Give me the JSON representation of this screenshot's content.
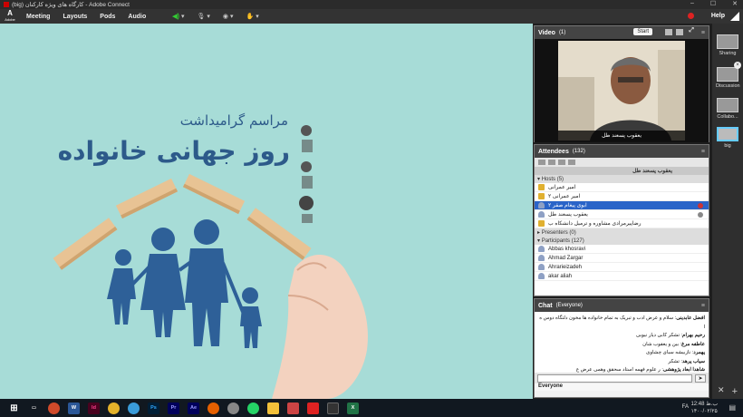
{
  "window": {
    "title": "(big) کارگاه های ویژه کارکنان - Adobe Connect"
  },
  "menubar": {
    "logo_letter": "A",
    "logo_sub": "Adobe",
    "items": [
      "Meeting",
      "Layouts",
      "Pods",
      "Audio"
    ],
    "help": "Help"
  },
  "stage": {
    "title_small": "مراسم گرامیداشت",
    "title_big": "روز جهانی خانواده"
  },
  "video_pod": {
    "title": "Video",
    "count": "(1)",
    "start_label": "Start",
    "person_name": "یعقوب پسعند طل"
  },
  "attendees_pod": {
    "title": "Attendees",
    "count": "(132)",
    "current_user": "یعقوب پسعند طل",
    "hosts_label": "Hosts (5)",
    "hosts": [
      {
        "name": "امیر عمرانی",
        "selected": false,
        "badge": ""
      },
      {
        "name": "امیر عمرانی ۲",
        "selected": false,
        "badge": ""
      },
      {
        "name": "۲ ابوی پیغام صقر",
        "selected": true,
        "badge": "red"
      },
      {
        "name": "یعقوب پسعند طل",
        "selected": false,
        "badge": "gray"
      },
      {
        "name": "رضاپیرمرادی مشاوره و ترمیل دانشکاه ب",
        "selected": false,
        "badge": ""
      }
    ],
    "presenters_label": "Presenters (0)",
    "participants_label": "Participants (127)",
    "participants": [
      "Abbas khosravi",
      "Ahmad Zargar",
      "Ahrarieizadeh",
      "akar aliah"
    ]
  },
  "chat_pod": {
    "title": "Chat",
    "scope": "(Everyone)",
    "messages": [
      {
        "user": "افضل عابدینی",
        "text": "سلام و عرض ادب و تبریک به تمام خانواده  ها مخون دلتگاه دوس ه ا"
      },
      {
        "user": "رحیم بهرام",
        "text": "تشکر کابی دیار نیوبی"
      },
      {
        "user": "عاطفه مرغ",
        "text": "بین و یعقوب شان"
      },
      {
        "user": "پهمرد",
        "text": "نازبیشه سبای چشاوی"
      },
      {
        "user": "سیاب پرهد",
        "text": "تشکر"
      },
      {
        "user": "شاهدا ابعاد پژوهشی",
        "text": "ر علوم فهمه استاد سحقق وهمی عرض ع"
      }
    ],
    "tab_label": "Everyone",
    "input_placeholder": ""
  },
  "layouts": [
    "Sharing",
    "Discussion",
    "Collabo...",
    "big"
  ],
  "taskbar": {
    "time": "12:48 ب.ظ",
    "date": "۱۴۰۰/۰۲/۲۵",
    "lang": "FA"
  },
  "colors": {
    "stage_bg": "#a7dcd7",
    "title_navy": "#2d5a8a",
    "family_blue": "#2e6098",
    "block_wood": "#e8c394",
    "selected_row": "#2a64c8"
  }
}
